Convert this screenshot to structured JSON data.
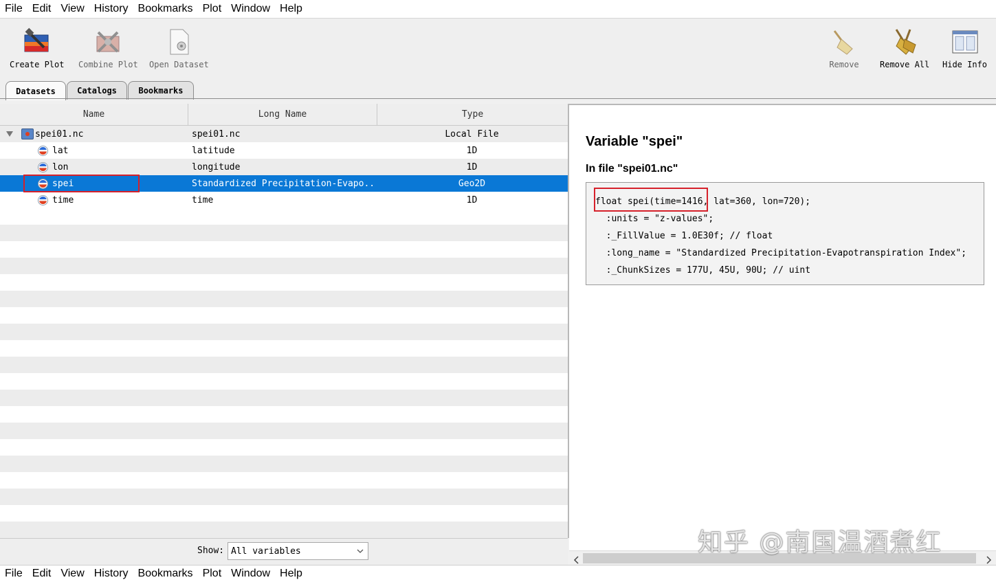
{
  "menu": [
    "File",
    "Edit",
    "View",
    "History",
    "Bookmarks",
    "Plot",
    "Window",
    "Help"
  ],
  "toolbar": {
    "create_plot": "Create Plot",
    "combine_plot": "Combine Plot",
    "open_dataset": "Open Dataset",
    "remove": "Remove",
    "remove_all": "Remove All",
    "hide_info": "Hide Info"
  },
  "tabs": [
    "Datasets",
    "Catalogs",
    "Bookmarks"
  ],
  "table": {
    "headers": [
      "Name",
      "Long Name",
      "Type"
    ],
    "rows": [
      {
        "name": "spei01.nc",
        "long_name": "spei01.nc",
        "type": "Local File"
      },
      {
        "name": "lat",
        "long_name": "latitude",
        "type": "1D"
      },
      {
        "name": "lon",
        "long_name": "longitude",
        "type": "1D"
      },
      {
        "name": "spei",
        "long_name": "Standardized Precipitation-Evapo..",
        "type": "Geo2D"
      },
      {
        "name": "time",
        "long_name": "time",
        "type": "1D"
      }
    ]
  },
  "show": {
    "label": "Show:",
    "value": "All variables"
  },
  "info": {
    "title": "Variable \"spei\"",
    "file": "In file \"spei01.nc\"",
    "code": [
      "float spei(time=1416, lat=360, lon=720);",
      "  :units = \"z-values\";",
      "  :_FillValue = 1.0E30f; // float",
      "  :long_name = \"Standardized Precipitation-Evapotranspiration Index\";",
      "  :_ChunkSizes = 177U, 45U, 90U; // uint"
    ]
  },
  "watermark": "知乎 @南国温酒煮红",
  "colors": {
    "selection": "#0a78d6",
    "highlight": "#d6202a"
  }
}
